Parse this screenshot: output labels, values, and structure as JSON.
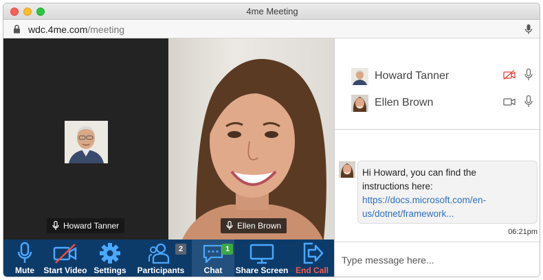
{
  "window": {
    "title": "4me Meeting"
  },
  "urlbar": {
    "host": "wdc.4me.com",
    "path": "/meeting"
  },
  "video": {
    "left_tile": {
      "name": "Howard Tanner"
    },
    "right_tile": {
      "name": "Ellen Brown"
    }
  },
  "toolbar": {
    "mute": "Mute",
    "start_video": "Start Video",
    "settings": "Settings",
    "participants": "Participants",
    "participants_count": "2",
    "chat": "Chat",
    "chat_count": "1",
    "share_screen": "Share Screen",
    "end_call": "End Call"
  },
  "participants": [
    {
      "name": "Howard Tanner",
      "video_icon": "video-off-icon",
      "mic_icon": "mic-icon"
    },
    {
      "name": "Ellen Brown",
      "video_icon": "video-camera-icon",
      "mic_icon": "mic-icon"
    }
  ],
  "chat": {
    "message_line1": "Hi Howard, you can find the",
    "message_line2": "instructions here:",
    "message_link_line1": "https://docs.microsoft.com/en-",
    "message_link_line2": "us/dotnet/framework...",
    "time": "06:21pm",
    "input_placeholder": "Type message here..."
  },
  "colors": {
    "toolbar": "#0d3b69",
    "chat_active": "#24507e",
    "end_call": "#ff5a4e",
    "badge_participants": "#5a6370",
    "badge_chat": "#3aa845",
    "link": "#2f6fc0"
  }
}
